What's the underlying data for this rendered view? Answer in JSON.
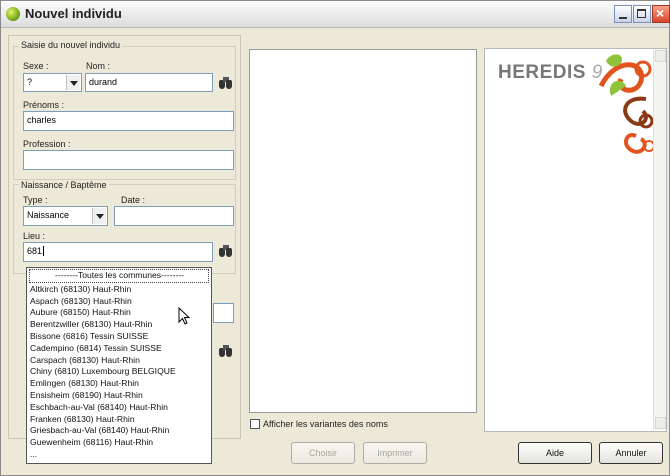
{
  "window": {
    "title": "Nouvel individu"
  },
  "form": {
    "group_label": "Saisie du nouvel individu",
    "sexe_label": "Sexe :",
    "sexe_value": "?",
    "nom_label": "Nom :",
    "nom_value": "durand",
    "prenoms_label": "Prénoms :",
    "prenoms_value": "charles",
    "profession_label": "Profession :",
    "profession_value": "",
    "naissance_group_label": "Naissance / Baptême",
    "type_label": "Type :",
    "type_value": "Naissance",
    "date_label": "Date :",
    "date_value": "",
    "lieu_label": "Lieu :",
    "lieu_value": "681"
  },
  "place_dropdown": {
    "items": [
      "--------Toutes les communes--------",
      "Altkirch (68130) Haut-Rhin",
      "Aspach (68130) Haut-Rhin",
      "Aubure (68150) Haut-Rhin",
      "Berentzwiller (68130) Haut-Rhin",
      "Bissone (6816) Tessin SUISSE",
      "Cadempino (6814) Tessin SUISSE",
      "Carspach (68130) Haut-Rhin",
      "Chiny (6810) Luxembourg BELGIQUE",
      "Emlingen (68130) Haut-Rhin",
      "Ensisheim (68190) Haut-Rhin",
      "Eschbach-au-Val (68140) Haut-Rhin",
      "Franken (68130) Haut-Rhin",
      "Griesbach-au-Val (68140) Haut-Rhin",
      "Guewenheim (68116) Haut-Rhin",
      "..."
    ]
  },
  "options": {
    "show_variants_label": "Afficher les variantes des noms",
    "show_variants_checked": false
  },
  "buttons": {
    "choisir": "Choisir",
    "imprimer": "Imprimer",
    "aide": "Aide",
    "annuler": "Annuler"
  },
  "branding": {
    "logo_text": "HEREDIS",
    "logo_version": "9"
  },
  "icons": {
    "app": "heredis-leaf-icon",
    "search": "binoculars-icon"
  },
  "colors": {
    "swirl_orange": "#e2541e",
    "swirl_brown": "#8a3a14",
    "leaf_green": "#8fc43a"
  }
}
